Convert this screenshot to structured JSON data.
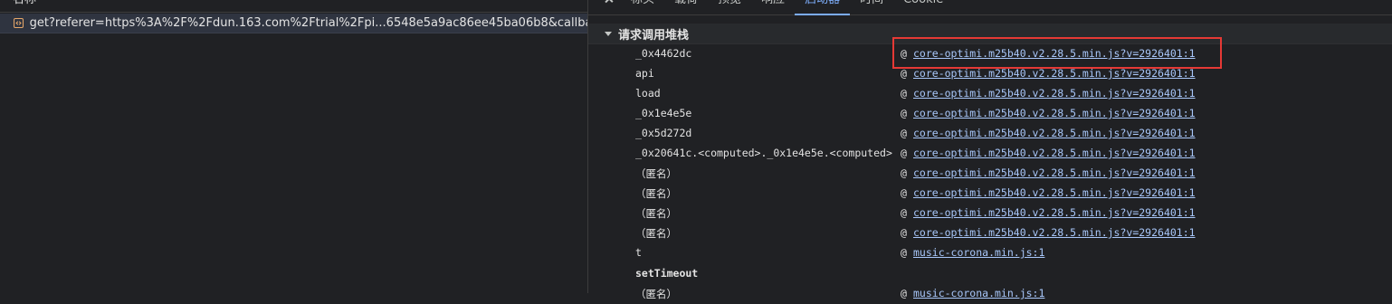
{
  "left_panel": {
    "column_header": "名称",
    "request_name": "get?referer=https%3A%2F%2Fdun.163.com%2Ftrial%2Fpi...6548e5a9ac86ee45ba06b8&callbac..."
  },
  "tabs": [
    {
      "label": "标头"
    },
    {
      "label": "载荷"
    },
    {
      "label": "预览"
    },
    {
      "label": "响应"
    },
    {
      "label": "启动器",
      "active": true
    },
    {
      "label": "时间"
    },
    {
      "label": "Cookie"
    }
  ],
  "section": {
    "title": "请求调用堆栈"
  },
  "frames": [
    {
      "fn": "_0x4462dc",
      "at": "@",
      "link": "core-optimi.m25b40.v2.28.5.min.js?v=2926401:1"
    },
    {
      "fn": "api",
      "at": "@",
      "link": "core-optimi.m25b40.v2.28.5.min.js?v=2926401:1"
    },
    {
      "fn": "load",
      "at": "@",
      "link": "core-optimi.m25b40.v2.28.5.min.js?v=2926401:1"
    },
    {
      "fn": "_0x1e4e5e",
      "at": "@",
      "link": "core-optimi.m25b40.v2.28.5.min.js?v=2926401:1"
    },
    {
      "fn": "_0x5d272d",
      "at": "@",
      "link": "core-optimi.m25b40.v2.28.5.min.js?v=2926401:1"
    },
    {
      "fn": "_0x20641c.<computed>._0x1e4e5e.<computed>",
      "at": "@",
      "link": "core-optimi.m25b40.v2.28.5.min.js?v=2926401:1"
    },
    {
      "fn": "（匿名）",
      "at": "@",
      "link": "core-optimi.m25b40.v2.28.5.min.js?v=2926401:1"
    },
    {
      "fn": "（匿名）",
      "at": "@",
      "link": "core-optimi.m25b40.v2.28.5.min.js?v=2926401:1"
    },
    {
      "fn": "（匿名）",
      "at": "@",
      "link": "core-optimi.m25b40.v2.28.5.min.js?v=2926401:1"
    },
    {
      "fn": "（匿名）",
      "at": "@",
      "link": "core-optimi.m25b40.v2.28.5.min.js?v=2926401:1"
    },
    {
      "fn": "t",
      "at": "@",
      "link": "music-corona.min.js:1"
    }
  ],
  "async_label": "setTimeout",
  "last_frame": {
    "fn": "（匿名）",
    "at": "@",
    "link": "music-corona.min.js:1"
  },
  "colors": {
    "background": "#202124",
    "link": "#a8c7fa",
    "active_tab": "#7cacf8",
    "highlight": "#e53935"
  }
}
